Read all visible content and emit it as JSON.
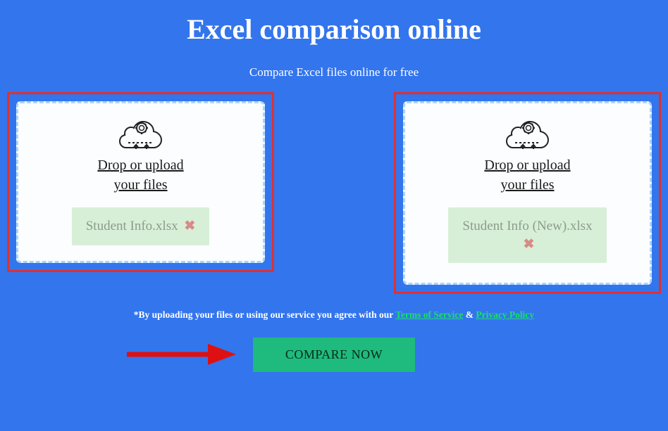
{
  "title": "Excel comparison online",
  "subtitle": "Compare Excel files online for free",
  "dropzones": {
    "label_line1": "Drop or upload",
    "label_line2": "your files",
    "left": {
      "file_name": "Student Info.xlsx"
    },
    "right": {
      "file_name": "Student Info (New).xlsx"
    }
  },
  "disclaimer": {
    "prefix": "*By uploading your files or using our service you agree with our ",
    "tos": "Terms of Service",
    "amp": " & ",
    "privacy": "Privacy Policy"
  },
  "compare_button": "COMPARE NOW"
}
